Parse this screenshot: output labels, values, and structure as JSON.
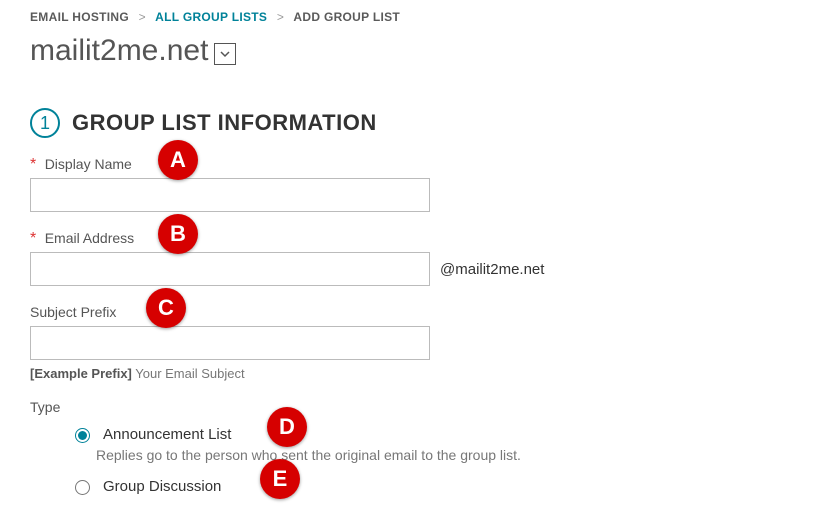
{
  "breadcrumb": {
    "root": "EMAIL HOSTING",
    "link": "ALL GROUP LISTS",
    "current": "ADD GROUP LIST"
  },
  "domain": {
    "name": "mailit2me.net"
  },
  "section": {
    "step": "1",
    "title": "GROUP LIST INFORMATION"
  },
  "fields": {
    "display_name": {
      "label": "Display Name",
      "value": ""
    },
    "email_address": {
      "label": "Email Address",
      "value": "",
      "suffix": "@mailit2me.net"
    },
    "subject_prefix": {
      "label": "Subject Prefix",
      "value": "",
      "hint_bold": "[Example Prefix]",
      "hint_rest": " Your Email Subject"
    },
    "type": {
      "label": "Type",
      "options": [
        {
          "label": "Announcement List",
          "desc": "Replies go to the person who sent the original email to the group list.",
          "checked": true
        },
        {
          "label": "Group Discussion",
          "desc": "",
          "checked": false
        }
      ]
    }
  },
  "annotations": {
    "a": "A",
    "b": "B",
    "c": "C",
    "d": "D",
    "e": "E"
  }
}
